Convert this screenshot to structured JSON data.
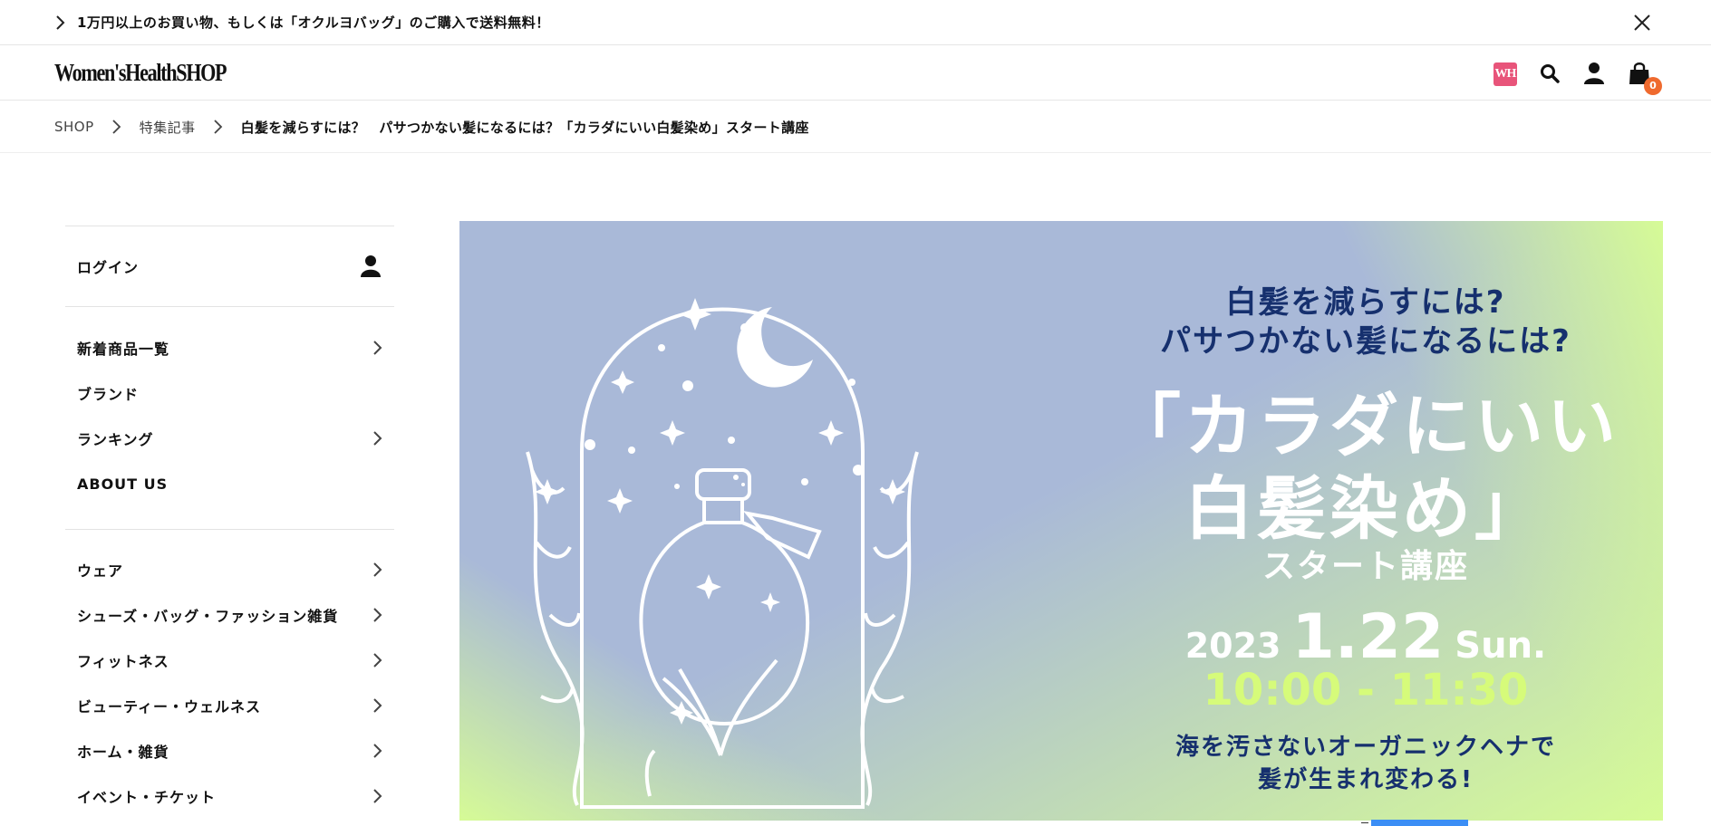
{
  "announcement": {
    "text": "1万円以上のお買い物、もしくは「オクルヨバッグ」のご購入で送料無料！"
  },
  "header": {
    "logo": "Women'sHealthSHOP",
    "wh_badge": "WH",
    "cart_count": "0"
  },
  "breadcrumb": {
    "items": [
      "SHOP",
      "特集記事"
    ],
    "current": "白髪を減らすには？　パサつかない髪になるには？「カラダにいい白髪染め」スタート講座"
  },
  "sidebar": {
    "login": "ログイン",
    "group1": [
      {
        "label": "新着商品一覧"
      },
      {
        "label": "ブランド"
      },
      {
        "label": "ランキング"
      },
      {
        "label": "ABOUT US"
      }
    ],
    "group2": [
      {
        "label": "ウェア"
      },
      {
        "label": "シューズ・バッグ・ファッション雑貨"
      },
      {
        "label": "フィットネス"
      },
      {
        "label": "ビューティー・ウェルネス"
      },
      {
        "label": "ホーム・雑貨"
      },
      {
        "label": "イベント・チケット"
      }
    ]
  },
  "hero": {
    "subtitle_line1": "白髪を減らすには?",
    "subtitle_line2": "パサつかない髪になるには?",
    "title_line1": "「カラダにいい",
    "title_line2": "白髪染め」",
    "title_suffix": "スタート講座",
    "year": "2023",
    "date": "1.22",
    "weekday": "Sun.",
    "time": "10:00 - 11:30",
    "footer_line1": "海を汚さないオーガニックヘナで",
    "footer_line2": "髪が生まれ変わる!",
    "colors": {
      "bluegray": "#a9b9d8",
      "lime": "#d6fb96",
      "navy": "#16306e"
    }
  },
  "icons": [
    "chevron-right-icon",
    "close-icon",
    "search-icon",
    "user-icon",
    "shopping-bag-icon"
  ]
}
